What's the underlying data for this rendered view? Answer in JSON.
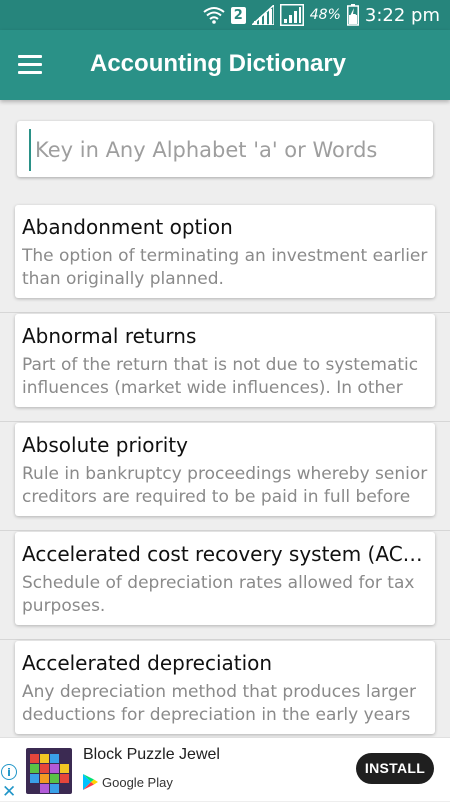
{
  "status_bar": {
    "sim_slot": "2",
    "battery_percent": "48%",
    "time": "3:22 pm"
  },
  "app_bar": {
    "title": "Accounting Dictionary"
  },
  "search": {
    "placeholder": "Key in Any Alphabet 'a' or Words",
    "value": ""
  },
  "terms": [
    {
      "title": "Abandonment option",
      "description": "The option of terminating an investment earlier than originally planned."
    },
    {
      "title": "Abnormal returns",
      "description": "Part of the return that is not due to systematic influences (market wide influences). In other"
    },
    {
      "title": "Absolute priority",
      "description": "Rule in bankruptcy proceedings whereby senior creditors are required to be paid in full before"
    },
    {
      "title": "Accelerated cost recovery system (AC…",
      "description": "Schedule of depreciation rates allowed for tax purposes."
    },
    {
      "title": "Accelerated depreciation",
      "description": "Any depreciation method that produces larger deductions for depreciation in the early years of"
    }
  ],
  "ad": {
    "app_name": "Block Puzzle Jewel",
    "store_name": "Google Play",
    "install_label": "INSTALL",
    "info_icon": "info-icon",
    "close_icon": "close-icon"
  },
  "colors": {
    "status_bar": "#26857c",
    "app_bar": "#2a9187",
    "background": "#eeeeee",
    "title_text": "#111111",
    "description_text": "#8a8a8a"
  }
}
